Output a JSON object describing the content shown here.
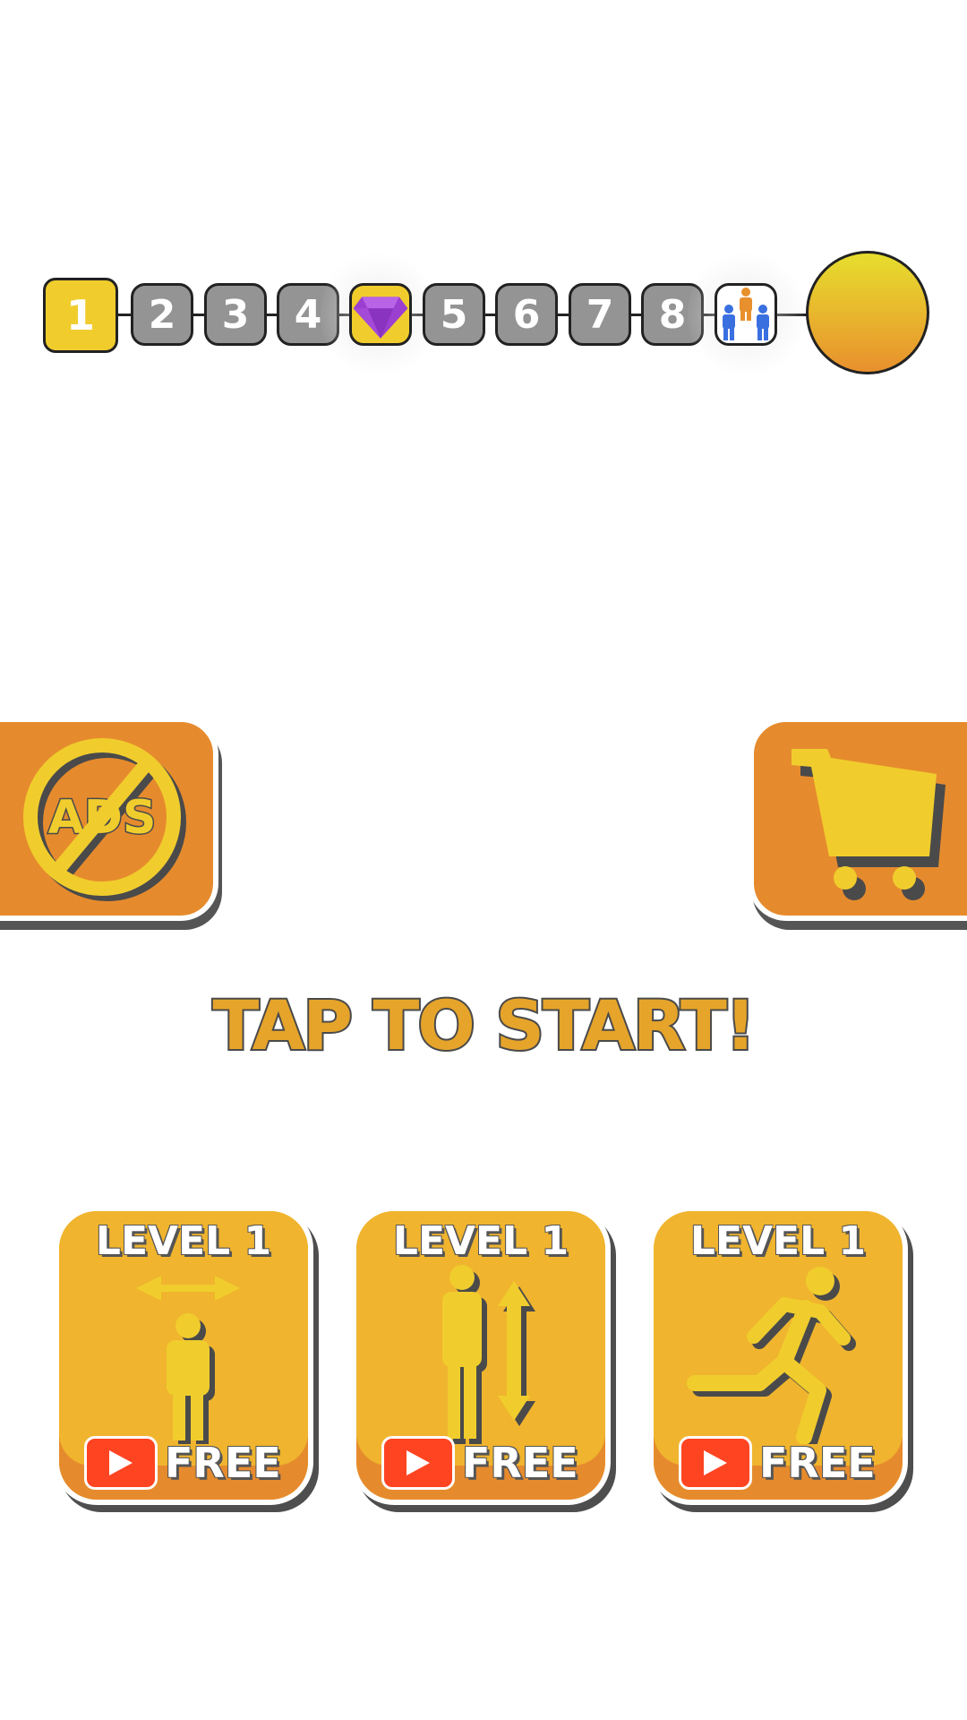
{
  "progress": {
    "steps": [
      {
        "label": "1",
        "state": "current"
      },
      {
        "label": "2",
        "state": "locked"
      },
      {
        "label": "3",
        "state": "locked"
      },
      {
        "label": "4",
        "state": "locked"
      },
      {
        "label": "",
        "state": "gem-reward",
        "icon": "purple-gem-icon"
      },
      {
        "label": "5",
        "state": "locked"
      },
      {
        "label": "6",
        "state": "locked"
      },
      {
        "label": "7",
        "state": "locked"
      },
      {
        "label": "8",
        "state": "locked"
      },
      {
        "label": "",
        "state": "team-reward",
        "icon": "crowd-icon"
      }
    ],
    "goal_icon": "gold-coin-icon"
  },
  "buttons": {
    "no_ads_icon": "no-ads-icon",
    "no_ads_text": "ADS",
    "shop_icon": "shopping-cart-icon"
  },
  "title": "TAP TO START!",
  "upgrades": [
    {
      "level": "LEVEL 1",
      "icon": "width-arrows-person-icon",
      "action": "FREE"
    },
    {
      "level": "LEVEL 1",
      "icon": "height-arrows-person-icon",
      "action": "FREE"
    },
    {
      "level": "LEVEL 1",
      "icon": "running-person-icon",
      "action": "FREE"
    }
  ],
  "colors": {
    "accent_yellow": "#f0cd2d",
    "orange": "#e68b2d",
    "card_yellow": "#f0b42e",
    "locked_gray": "#949494",
    "video_red": "#ff4422",
    "gem_purple": "#9b3fd0"
  }
}
